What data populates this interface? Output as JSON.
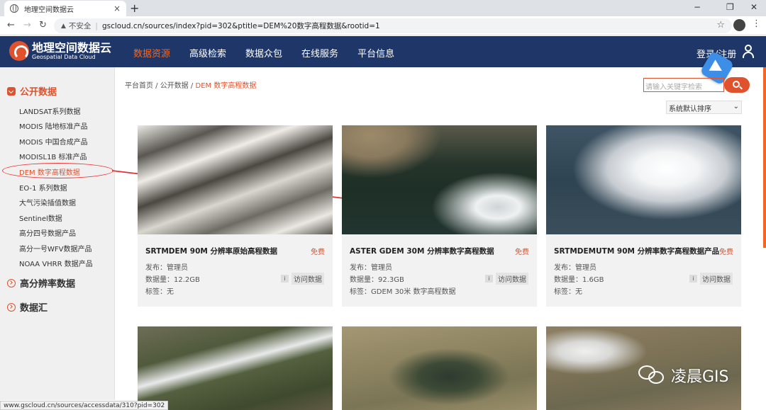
{
  "browser": {
    "tab_title": "地理空间数据云",
    "tab_close": "×",
    "new_tab": "+",
    "window_controls": [
      "−",
      "❐",
      "✕"
    ],
    "insecure_label": "不安全",
    "url": "gscloud.cn/sources/index?pid=302&ptitle=DEM%20数字高程数据&rootid=1",
    "status_url": "www.gscloud.cn/sources/accessdata/310?pid=302"
  },
  "header": {
    "logo_cn": "地理空间数据云",
    "logo_en": "Geospatial Data Cloud",
    "nav": [
      "数据资源",
      "高级检索",
      "数据众包",
      "在线服务",
      "平台信息"
    ],
    "active_nav": "数据资源",
    "login": "登录/注册"
  },
  "sidebar": {
    "sections": [
      {
        "title": "公开数据",
        "expanded": true,
        "items": [
          "LANDSAT系列数据",
          "MODIS 陆地标准产品",
          "MODIS 中国合成产品",
          "MODISL1B 标准产品",
          "DEM 数字高程数据",
          "EO-1 系列数据",
          "大气污染插值数据",
          "Sentinel数据",
          "高分四号数据产品",
          "高分一号WFV数据产品",
          "NOAA VHRR 数据产品"
        ]
      },
      {
        "title": "高分辨率数据",
        "expanded": false
      },
      {
        "title": "数据汇",
        "expanded": false
      }
    ],
    "active_item": "DEM 数字高程数据"
  },
  "breadcrumb": {
    "home": "平台首页 /",
    "level1": "公开数据 /",
    "current": "DEM 数字高程数据"
  },
  "search": {
    "placeholder": "请输入关键字检索"
  },
  "sort": {
    "selected": "系统默认排序",
    "arrow": "⌄"
  },
  "cards": [
    {
      "title": "SRTMDEM 90M 分辨率原始高程数据",
      "badge": "免费",
      "publisher": "发布：管理员",
      "size": "数据量：12.2GB",
      "tags": "标签：无",
      "info": "i",
      "visit": "访问数据"
    },
    {
      "title": "ASTER GDEM 30M 分辨率数字高程数据",
      "badge": "免费",
      "publisher": "发布：管理员",
      "size": "数据量：92.3GB",
      "tags": "标签：GDEM 30米 数字高程数据",
      "info": "i",
      "visit": "访问数据"
    },
    {
      "title": "SRTMDEMUTM 90M 分辨率数字高程数据产品",
      "badge": "免费",
      "publisher": "发布：管理员",
      "size": "数据量：1.6GB",
      "tags": "标签：无",
      "info": "i",
      "visit": "访问数据"
    }
  ],
  "watermark": "凌晨GIS",
  "colors": {
    "accent": "#e0522b",
    "header_bg": "#1f3768",
    "annotation": "#e33333"
  }
}
